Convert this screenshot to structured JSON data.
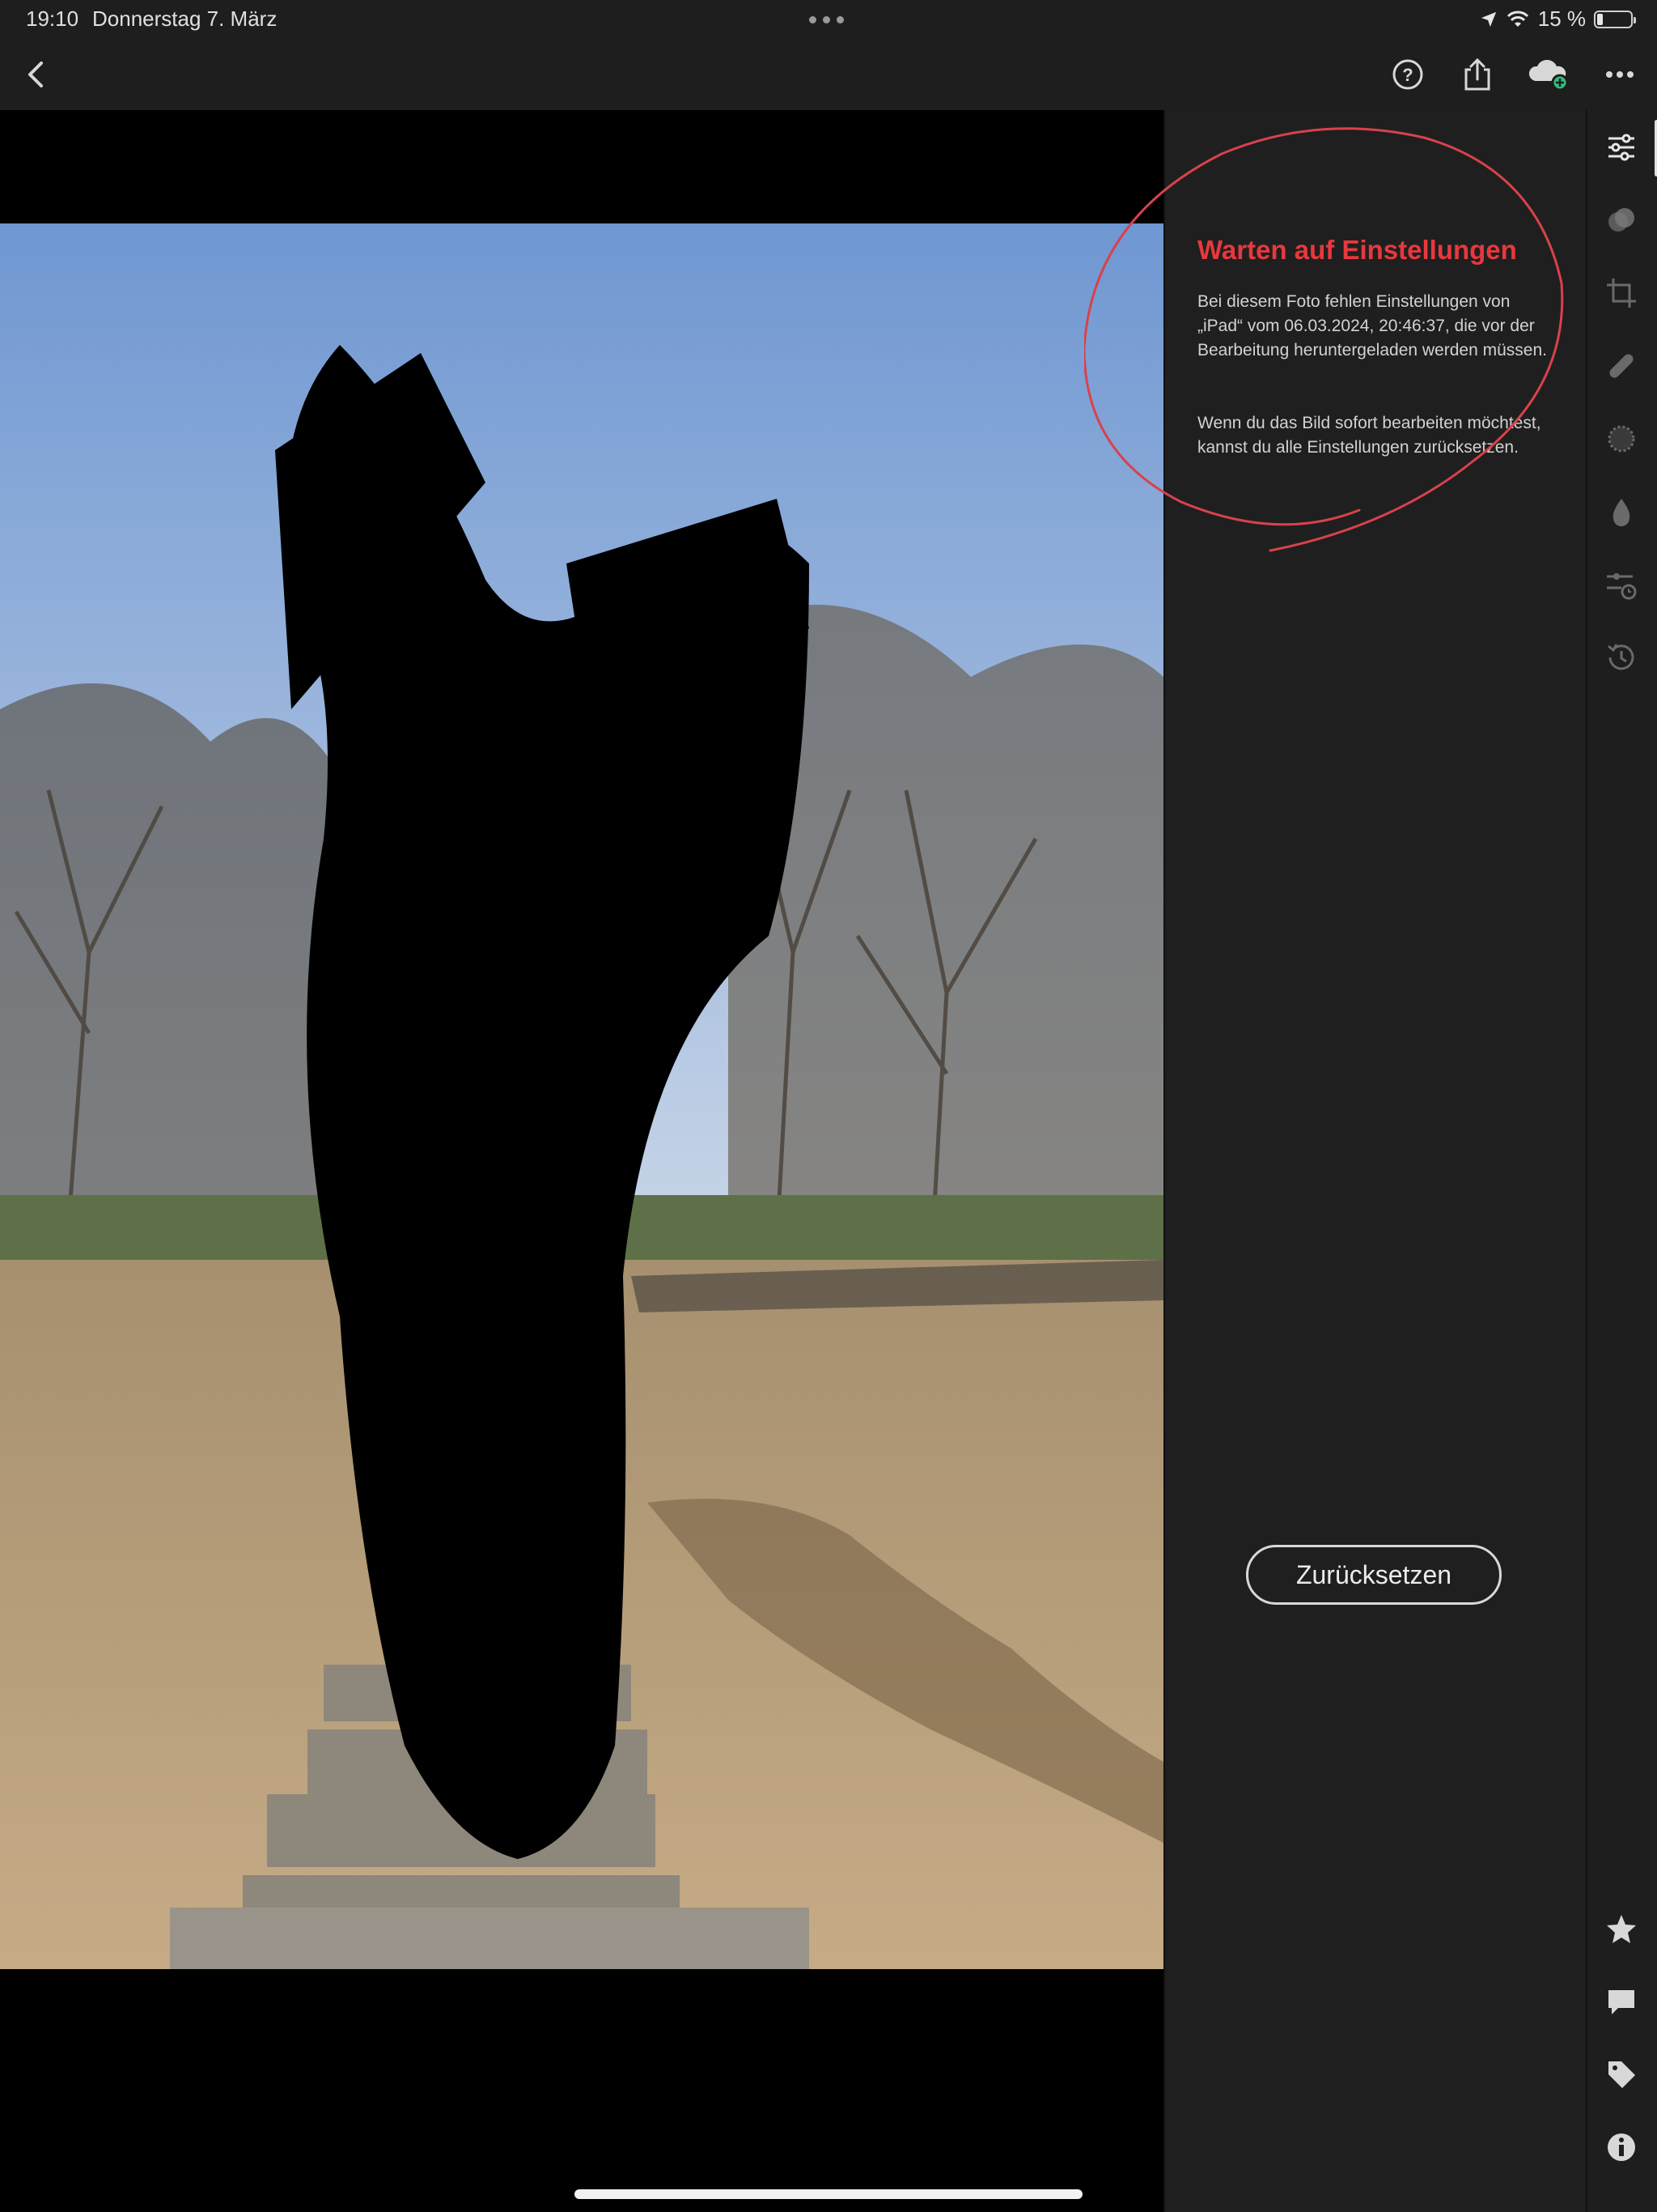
{
  "status": {
    "time": "19:10",
    "date": "Donnerstag 7. März",
    "battery": "15 %",
    "battery_level": 0.15
  },
  "toolbar": {
    "back_icon": "chevron-left-icon",
    "help_icon": "help-circle-icon",
    "share_icon": "share-icon",
    "cloud_icon": "cloud-sync-icon",
    "more_icon": "more-horizontal-icon"
  },
  "panel": {
    "title": "Warten auf Einstellungen",
    "text1": "Bei diesem Foto fehlen Einstellungen von „iPad“ vom 06.03.2024, 20:46:37, die vor der Bearbeitung heruntergeladen werden müssen.",
    "text2": "Wenn du das Bild sofort bearbeiten möchtest, kannst du alle Einstellungen zurücksetzen.",
    "reset_label": "Zurücksetzen"
  },
  "rail": {
    "items": [
      "edit-sliders-icon",
      "presets-icon",
      "crop-icon",
      "healing-icon",
      "masking-icon",
      "selective-icon",
      "versions-icon",
      "history-icon"
    ],
    "bottom": [
      "star-icon",
      "comment-icon",
      "tag-icon",
      "info-icon"
    ]
  },
  "colors": {
    "accent_red": "#e8383d",
    "cloud_badge": "#2ebf7a"
  }
}
